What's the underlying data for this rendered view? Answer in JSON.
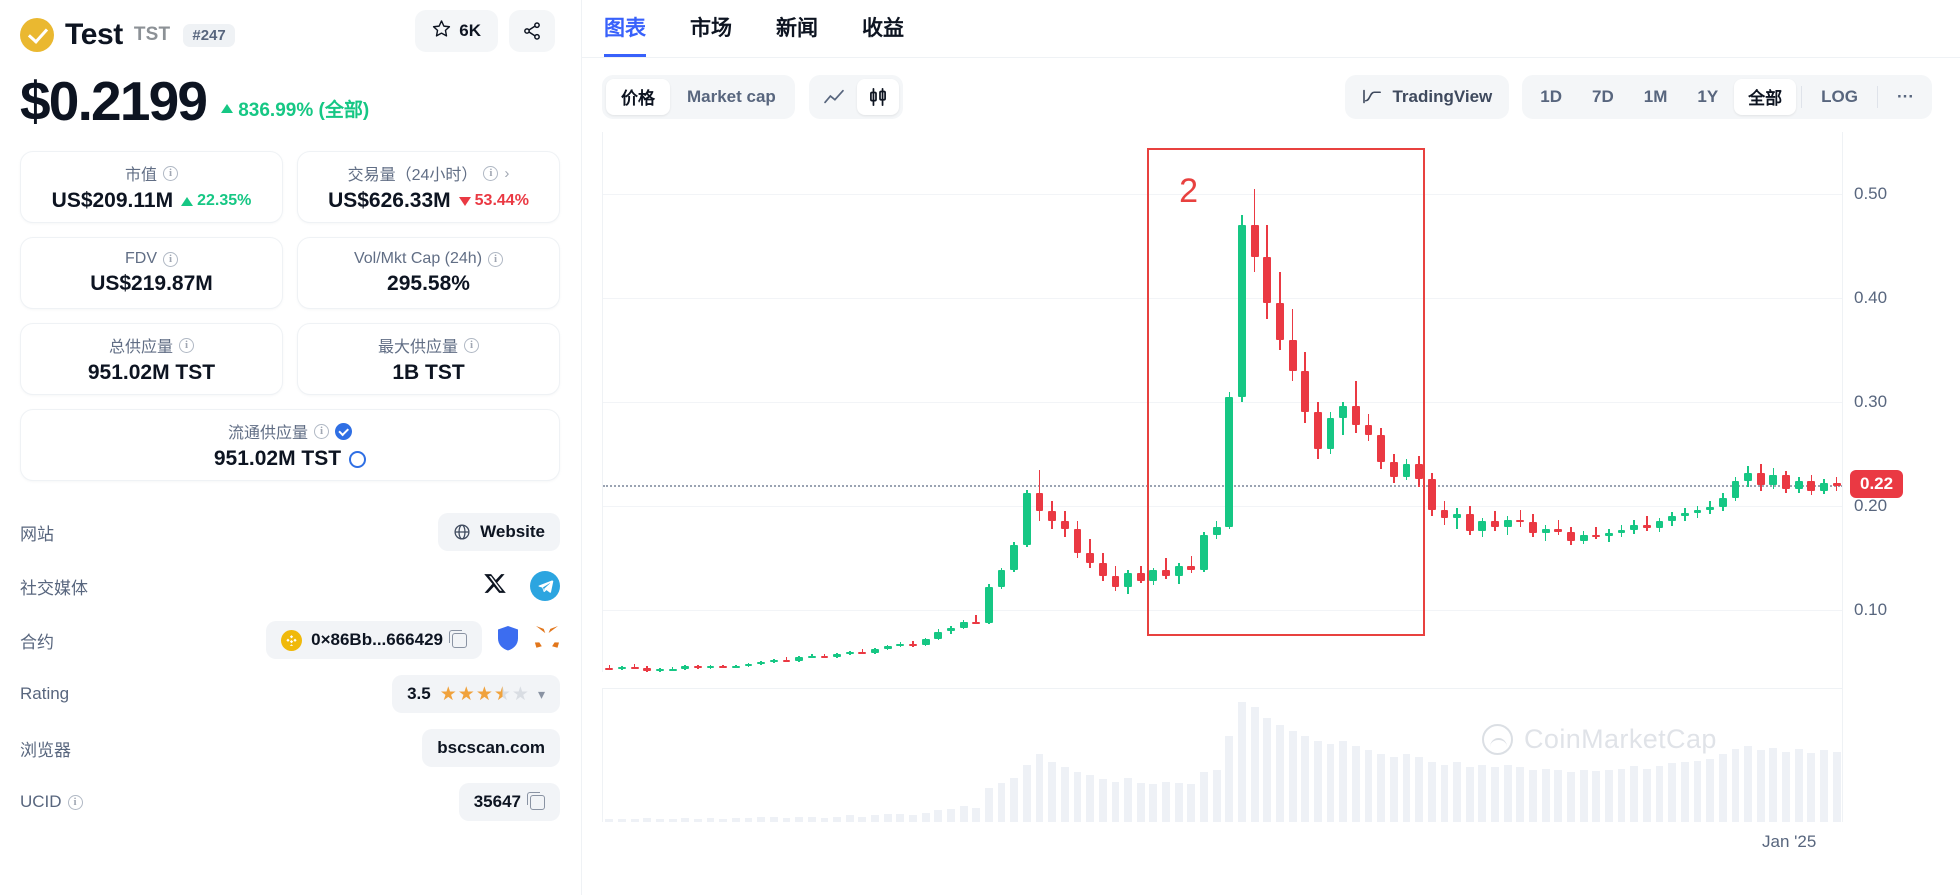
{
  "coin": {
    "name": "Test",
    "ticker": "TST",
    "rank": "#247",
    "watch_count": "6K",
    "price": "$0.2199",
    "change_pct": "836.99% (全部)"
  },
  "stats": [
    {
      "label": "市值",
      "value": "US$209.11M",
      "change": "22.35%",
      "dir": "up",
      "has_info": true
    },
    {
      "label": "交易量（24小时）",
      "value": "US$626.33M",
      "change": "53.44%",
      "dir": "down",
      "has_info": true,
      "has_chevron": true
    },
    {
      "label": "FDV",
      "value": "US$219.87M",
      "has_info": true
    },
    {
      "label": "Vol/Mkt Cap (24h)",
      "value": "295.58%",
      "has_info": true
    },
    {
      "label": "总供应量",
      "value": "951.02M TST",
      "has_info": true
    },
    {
      "label": "最大供应量",
      "value": "1B TST",
      "has_info": true
    },
    {
      "label": "流通供应量",
      "value": "951.02M TST",
      "has_info": true,
      "verified": true,
      "ring": true
    }
  ],
  "links": {
    "website_label": "网站",
    "website_value": "Website",
    "social_label": "社交媒体",
    "contract_label": "合约",
    "contract_value": "0×86Bb...666429",
    "rating_label": "Rating",
    "rating_value": "3.5",
    "explorer_label": "浏览器",
    "explorer_value": "bscscan.com",
    "ucid_label": "UCID",
    "ucid_value": "35647"
  },
  "tabs": [
    {
      "label": "图表",
      "active": true
    },
    {
      "label": "市场",
      "active": false
    },
    {
      "label": "新闻",
      "active": false
    },
    {
      "label": "收益",
      "active": false
    }
  ],
  "toolbar": {
    "metric": [
      {
        "label": "价格",
        "active": true
      },
      {
        "label": "Market cap",
        "active": false
      }
    ],
    "chart_type": [
      {
        "label": "line-chart-icon",
        "active": false
      },
      {
        "label": "candlestick-chart-icon",
        "active": true
      }
    ],
    "tradingview_label": "TradingView",
    "timeframes": [
      {
        "label": "1D",
        "active": false
      },
      {
        "label": "7D",
        "active": false
      },
      {
        "label": "1M",
        "active": false
      },
      {
        "label": "1Y",
        "active": false
      },
      {
        "label": "全部",
        "active": true
      }
    ],
    "log_label": "LOG",
    "more_label": "···"
  },
  "chart_data": {
    "type": "line",
    "subtype": "candlestick",
    "title": "",
    "xlabel": "",
    "ylabel": "",
    "ylim": [
      0.04,
      0.56
    ],
    "ytick_labels": [
      "0.50",
      "0.40",
      "0.30",
      "0.20",
      "0.10"
    ],
    "ytick_values": [
      0.5,
      0.4,
      0.3,
      0.2,
      0.1
    ],
    "xtick_labels": [
      "Jan '25"
    ],
    "grid": true,
    "current_price_label": "0.22",
    "current_price": 0.22,
    "watermark": "CoinMarketCap",
    "annotation": {
      "label": "2",
      "color": "#e8413f",
      "x_start": 43,
      "x_end": 65,
      "y_top": 0.545,
      "y_bottom": 0.075
    },
    "candles": [
      {
        "o": 0.044,
        "h": 0.047,
        "l": 0.042,
        "c": 0.043
      },
      {
        "o": 0.043,
        "h": 0.046,
        "l": 0.042,
        "c": 0.045
      },
      {
        "o": 0.045,
        "h": 0.048,
        "l": 0.043,
        "c": 0.044
      },
      {
        "o": 0.044,
        "h": 0.046,
        "l": 0.04,
        "c": 0.041
      },
      {
        "o": 0.041,
        "h": 0.044,
        "l": 0.04,
        "c": 0.043
      },
      {
        "o": 0.043,
        "h": 0.045,
        "l": 0.042,
        "c": 0.043
      },
      {
        "o": 0.043,
        "h": 0.047,
        "l": 0.042,
        "c": 0.046
      },
      {
        "o": 0.046,
        "h": 0.047,
        "l": 0.043,
        "c": 0.044
      },
      {
        "o": 0.044,
        "h": 0.047,
        "l": 0.043,
        "c": 0.046
      },
      {
        "o": 0.046,
        "h": 0.047,
        "l": 0.044,
        "c": 0.045
      },
      {
        "o": 0.045,
        "h": 0.047,
        "l": 0.044,
        "c": 0.046
      },
      {
        "o": 0.046,
        "h": 0.049,
        "l": 0.045,
        "c": 0.048
      },
      {
        "o": 0.048,
        "h": 0.051,
        "l": 0.047,
        "c": 0.05
      },
      {
        "o": 0.05,
        "h": 0.053,
        "l": 0.049,
        "c": 0.052
      },
      {
        "o": 0.052,
        "h": 0.054,
        "l": 0.05,
        "c": 0.051
      },
      {
        "o": 0.051,
        "h": 0.055,
        "l": 0.05,
        "c": 0.054
      },
      {
        "o": 0.054,
        "h": 0.057,
        "l": 0.053,
        "c": 0.055
      },
      {
        "o": 0.055,
        "h": 0.057,
        "l": 0.053,
        "c": 0.054
      },
      {
        "o": 0.054,
        "h": 0.058,
        "l": 0.053,
        "c": 0.057
      },
      {
        "o": 0.057,
        "h": 0.06,
        "l": 0.056,
        "c": 0.059
      },
      {
        "o": 0.059,
        "h": 0.062,
        "l": 0.057,
        "c": 0.058
      },
      {
        "o": 0.058,
        "h": 0.063,
        "l": 0.057,
        "c": 0.062
      },
      {
        "o": 0.062,
        "h": 0.066,
        "l": 0.061,
        "c": 0.065
      },
      {
        "o": 0.065,
        "h": 0.069,
        "l": 0.064,
        "c": 0.067
      },
      {
        "o": 0.067,
        "h": 0.07,
        "l": 0.064,
        "c": 0.066
      },
      {
        "o": 0.066,
        "h": 0.073,
        "l": 0.065,
        "c": 0.072
      },
      {
        "o": 0.072,
        "h": 0.081,
        "l": 0.071,
        "c": 0.079
      },
      {
        "o": 0.079,
        "h": 0.084,
        "l": 0.077,
        "c": 0.082
      },
      {
        "o": 0.082,
        "h": 0.09,
        "l": 0.081,
        "c": 0.088
      },
      {
        "o": 0.088,
        "h": 0.095,
        "l": 0.086,
        "c": 0.087
      },
      {
        "o": 0.087,
        "h": 0.125,
        "l": 0.086,
        "c": 0.122
      },
      {
        "o": 0.122,
        "h": 0.14,
        "l": 0.12,
        "c": 0.138
      },
      {
        "o": 0.138,
        "h": 0.165,
        "l": 0.136,
        "c": 0.162
      },
      {
        "o": 0.162,
        "h": 0.215,
        "l": 0.16,
        "c": 0.212
      },
      {
        "o": 0.212,
        "h": 0.235,
        "l": 0.185,
        "c": 0.195
      },
      {
        "o": 0.195,
        "h": 0.205,
        "l": 0.178,
        "c": 0.185
      },
      {
        "o": 0.185,
        "h": 0.195,
        "l": 0.17,
        "c": 0.178
      },
      {
        "o": 0.178,
        "h": 0.185,
        "l": 0.15,
        "c": 0.155
      },
      {
        "o": 0.155,
        "h": 0.168,
        "l": 0.14,
        "c": 0.145
      },
      {
        "o": 0.145,
        "h": 0.155,
        "l": 0.128,
        "c": 0.132
      },
      {
        "o": 0.132,
        "h": 0.142,
        "l": 0.118,
        "c": 0.122
      },
      {
        "o": 0.122,
        "h": 0.138,
        "l": 0.115,
        "c": 0.135
      },
      {
        "o": 0.135,
        "h": 0.142,
        "l": 0.126,
        "c": 0.128
      },
      {
        "o": 0.128,
        "h": 0.14,
        "l": 0.124,
        "c": 0.138
      },
      {
        "o": 0.138,
        "h": 0.15,
        "l": 0.13,
        "c": 0.132
      },
      {
        "o": 0.132,
        "h": 0.145,
        "l": 0.125,
        "c": 0.142
      },
      {
        "o": 0.142,
        "h": 0.152,
        "l": 0.135,
        "c": 0.138
      },
      {
        "o": 0.138,
        "h": 0.175,
        "l": 0.136,
        "c": 0.172
      },
      {
        "o": 0.172,
        "h": 0.185,
        "l": 0.168,
        "c": 0.18
      },
      {
        "o": 0.18,
        "h": 0.31,
        "l": 0.178,
        "c": 0.305
      },
      {
        "o": 0.305,
        "h": 0.48,
        "l": 0.3,
        "c": 0.47
      },
      {
        "o": 0.47,
        "h": 0.505,
        "l": 0.425,
        "c": 0.44
      },
      {
        "o": 0.44,
        "h": 0.47,
        "l": 0.38,
        "c": 0.395
      },
      {
        "o": 0.395,
        "h": 0.425,
        "l": 0.35,
        "c": 0.36
      },
      {
        "o": 0.36,
        "h": 0.39,
        "l": 0.32,
        "c": 0.33
      },
      {
        "o": 0.33,
        "h": 0.348,
        "l": 0.28,
        "c": 0.29
      },
      {
        "o": 0.29,
        "h": 0.3,
        "l": 0.245,
        "c": 0.255
      },
      {
        "o": 0.255,
        "h": 0.29,
        "l": 0.25,
        "c": 0.285
      },
      {
        "o": 0.285,
        "h": 0.3,
        "l": 0.268,
        "c": 0.296
      },
      {
        "o": 0.296,
        "h": 0.32,
        "l": 0.27,
        "c": 0.278
      },
      {
        "o": 0.278,
        "h": 0.288,
        "l": 0.262,
        "c": 0.268
      },
      {
        "o": 0.268,
        "h": 0.275,
        "l": 0.235,
        "c": 0.242
      },
      {
        "o": 0.242,
        "h": 0.25,
        "l": 0.222,
        "c": 0.228
      },
      {
        "o": 0.228,
        "h": 0.245,
        "l": 0.225,
        "c": 0.24
      },
      {
        "o": 0.24,
        "h": 0.248,
        "l": 0.218,
        "c": 0.226
      },
      {
        "o": 0.226,
        "h": 0.232,
        "l": 0.19,
        "c": 0.196
      },
      {
        "o": 0.196,
        "h": 0.205,
        "l": 0.182,
        "c": 0.188
      },
      {
        "o": 0.188,
        "h": 0.198,
        "l": 0.178,
        "c": 0.192
      },
      {
        "o": 0.192,
        "h": 0.2,
        "l": 0.172,
        "c": 0.176
      },
      {
        "o": 0.176,
        "h": 0.188,
        "l": 0.17,
        "c": 0.185
      },
      {
        "o": 0.185,
        "h": 0.195,
        "l": 0.176,
        "c": 0.18
      },
      {
        "o": 0.18,
        "h": 0.19,
        "l": 0.172,
        "c": 0.186
      },
      {
        "o": 0.186,
        "h": 0.196,
        "l": 0.18,
        "c": 0.184
      },
      {
        "o": 0.184,
        "h": 0.192,
        "l": 0.17,
        "c": 0.174
      },
      {
        "o": 0.174,
        "h": 0.182,
        "l": 0.166,
        "c": 0.178
      },
      {
        "o": 0.178,
        "h": 0.186,
        "l": 0.172,
        "c": 0.175
      },
      {
        "o": 0.175,
        "h": 0.18,
        "l": 0.162,
        "c": 0.166
      },
      {
        "o": 0.166,
        "h": 0.176,
        "l": 0.163,
        "c": 0.172
      },
      {
        "o": 0.172,
        "h": 0.18,
        "l": 0.168,
        "c": 0.171
      },
      {
        "o": 0.171,
        "h": 0.178,
        "l": 0.165,
        "c": 0.174
      },
      {
        "o": 0.174,
        "h": 0.182,
        "l": 0.17,
        "c": 0.177
      },
      {
        "o": 0.177,
        "h": 0.186,
        "l": 0.173,
        "c": 0.182
      },
      {
        "o": 0.182,
        "h": 0.19,
        "l": 0.176,
        "c": 0.179
      },
      {
        "o": 0.179,
        "h": 0.188,
        "l": 0.175,
        "c": 0.185
      },
      {
        "o": 0.185,
        "h": 0.194,
        "l": 0.181,
        "c": 0.19
      },
      {
        "o": 0.19,
        "h": 0.198,
        "l": 0.185,
        "c": 0.193
      },
      {
        "o": 0.193,
        "h": 0.2,
        "l": 0.188,
        "c": 0.196
      },
      {
        "o": 0.196,
        "h": 0.205,
        "l": 0.192,
        "c": 0.199
      },
      {
        "o": 0.199,
        "h": 0.212,
        "l": 0.195,
        "c": 0.208
      },
      {
        "o": 0.208,
        "h": 0.228,
        "l": 0.205,
        "c": 0.224
      },
      {
        "o": 0.224,
        "h": 0.238,
        "l": 0.218,
        "c": 0.232
      },
      {
        "o": 0.232,
        "h": 0.24,
        "l": 0.214,
        "c": 0.22
      },
      {
        "o": 0.22,
        "h": 0.236,
        "l": 0.216,
        "c": 0.23
      },
      {
        "o": 0.23,
        "h": 0.234,
        "l": 0.212,
        "c": 0.216
      },
      {
        "o": 0.216,
        "h": 0.228,
        "l": 0.212,
        "c": 0.224
      },
      {
        "o": 0.224,
        "h": 0.23,
        "l": 0.21,
        "c": 0.214
      },
      {
        "o": 0.214,
        "h": 0.226,
        "l": 0.211,
        "c": 0.222
      },
      {
        "o": 0.222,
        "h": 0.228,
        "l": 0.214,
        "c": 0.219
      }
    ],
    "volumes": [
      2,
      2,
      2,
      3,
      2,
      2,
      3,
      2,
      3,
      2,
      3,
      3,
      4,
      4,
      3,
      4,
      4,
      3,
      4,
      5,
      4,
      5,
      6,
      6,
      5,
      7,
      9,
      10,
      12,
      11,
      26,
      30,
      34,
      44,
      52,
      46,
      42,
      38,
      36,
      33,
      31,
      34,
      30,
      29,
      31,
      30,
      29,
      38,
      40,
      66,
      92,
      88,
      80,
      74,
      70,
      66,
      62,
      60,
      62,
      58,
      55,
      52,
      50,
      52,
      50,
      46,
      44,
      46,
      42,
      44,
      42,
      44,
      42,
      40,
      41,
      40,
      38,
      40,
      39,
      40,
      41,
      43,
      41,
      43,
      45,
      46,
      47,
      48,
      52,
      56,
      58,
      55,
      57,
      54,
      56,
      53,
      55,
      54
    ]
  }
}
